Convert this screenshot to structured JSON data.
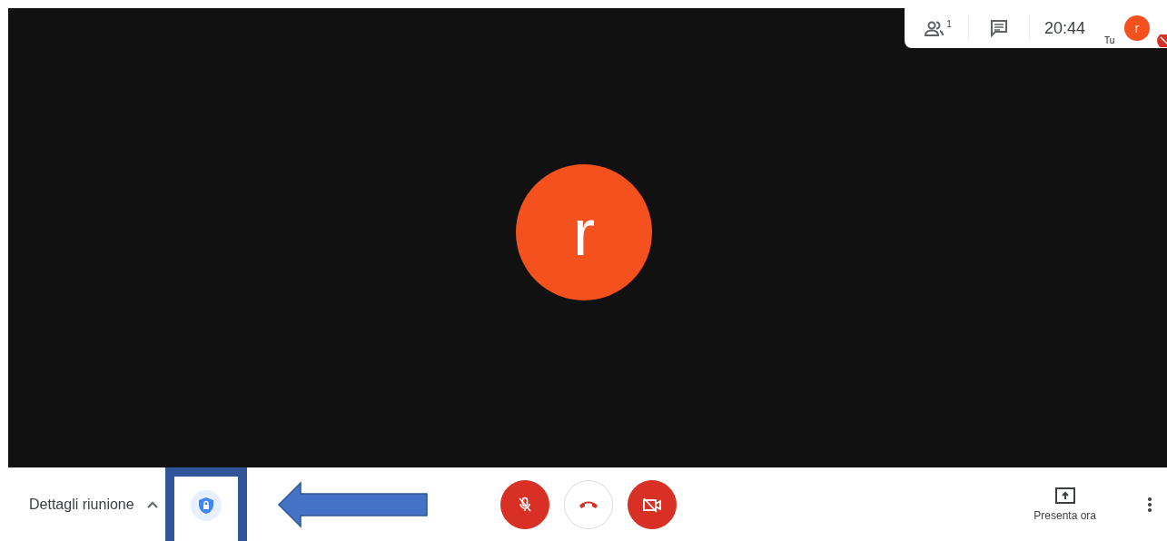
{
  "top_panel": {
    "participant_count": "1",
    "time": "20:44",
    "self_label": "Tu",
    "self_initial": "r"
  },
  "stage": {
    "participant_initial": "r"
  },
  "bottom_bar": {
    "details_label": "Dettagli riunione",
    "details_expanded": false,
    "controls": [
      {
        "kind": "mic",
        "on": false
      },
      {
        "kind": "hangup"
      },
      {
        "kind": "camera",
        "on": false
      }
    ],
    "present_label": "Presenta ora"
  }
}
